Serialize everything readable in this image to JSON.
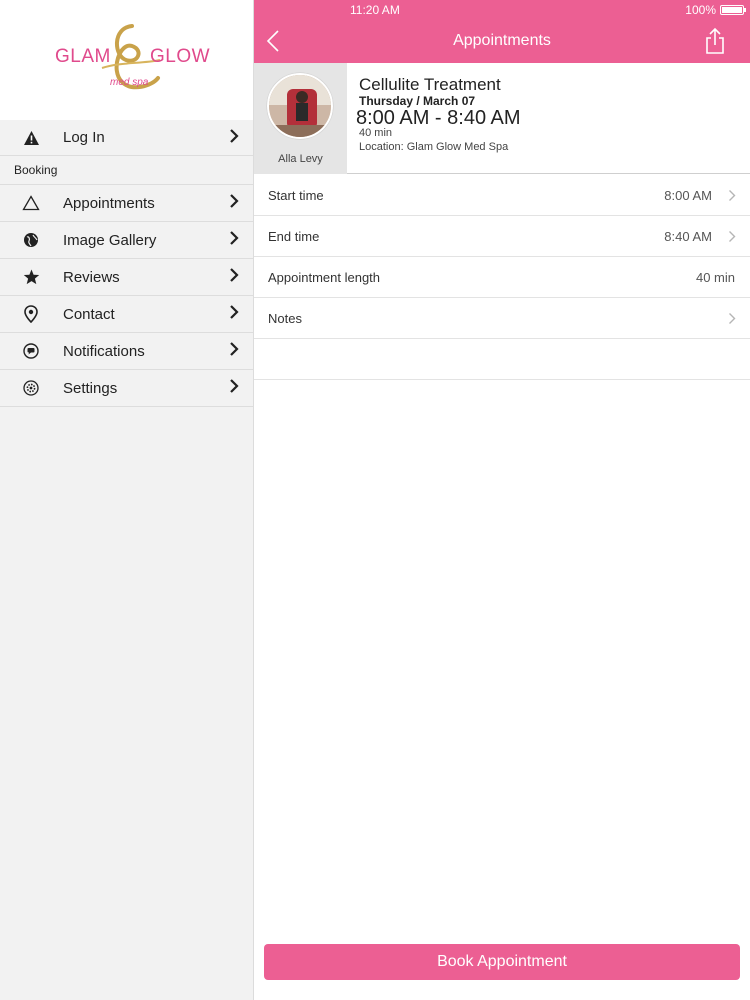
{
  "status_bar": {
    "time": "11:20 AM",
    "battery": "100%"
  },
  "brand": {
    "name_left": "GLAM",
    "name_right": "GLOW",
    "tagline": "med spa",
    "accent": "#ec5f93",
    "gold": "#c9a24a"
  },
  "sidebar": {
    "login": {
      "label": "Log In",
      "icon": "warning-icon"
    },
    "section_header": "Booking",
    "items": [
      {
        "label": "Appointments",
        "icon": "triangle-icon"
      },
      {
        "label": "Image Gallery",
        "icon": "globe-icon"
      },
      {
        "label": "Reviews",
        "icon": "star-icon"
      },
      {
        "label": "Contact",
        "icon": "location-pin-icon"
      },
      {
        "label": "Notifications",
        "icon": "chat-bubble-icon"
      },
      {
        "label": "Settings",
        "icon": "gear-icon"
      }
    ]
  },
  "header": {
    "title": "Appointments"
  },
  "appointment": {
    "staff_name": "Alla Levy",
    "service": "Cellulite Treatment",
    "date": "Thursday / March 07",
    "time_range": "8:00 AM - 8:40 AM",
    "length": "40 min",
    "location": "Location: Glam Glow Med Spa"
  },
  "details": [
    {
      "label": "Start time",
      "value": "8:00 AM",
      "chevron": true
    },
    {
      "label": "End time",
      "value": "8:40 AM",
      "chevron": true
    },
    {
      "label": "Appointment length",
      "value": "40 min",
      "chevron": false
    },
    {
      "label": "Notes",
      "value": "",
      "chevron": true
    }
  ],
  "footer": {
    "book_label": "Book Appointment"
  }
}
